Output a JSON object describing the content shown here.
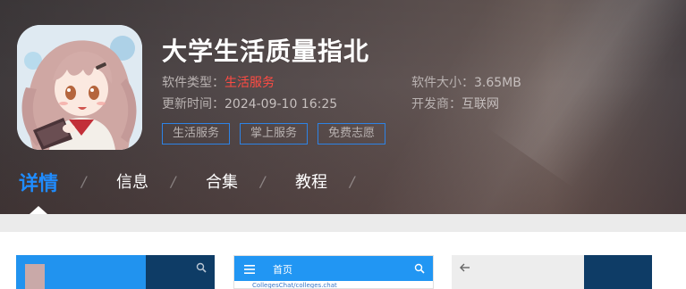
{
  "app": {
    "title": "大学生活质量指北",
    "type_label": "软件类型：",
    "type_value": "生活服务",
    "updated_label": "更新时间：",
    "updated_value": "2024-09-10 16:25",
    "size_label": "软件大小：",
    "size_value": "3.65MB",
    "developer_label": "开发商：",
    "developer_value": "互联网",
    "tags": [
      "生活服务",
      "掌上服务",
      "免费志愿"
    ],
    "icon": "anime-girl-app-icon"
  },
  "tabs": [
    {
      "label": "详情",
      "active": true
    },
    {
      "label": "信息",
      "active": false
    },
    {
      "label": "合集",
      "active": false
    },
    {
      "label": "教程",
      "active": false
    }
  ],
  "tab_separator": "/",
  "screenshots": {
    "shot2_title": "首页",
    "shot2_url": "CollegesChat/colleges.chat"
  },
  "colors": {
    "accent": "#1f8cff",
    "highlight": "#ff4b43",
    "tag_border": "#2d83e6",
    "preview_blue": "#2196f3"
  }
}
